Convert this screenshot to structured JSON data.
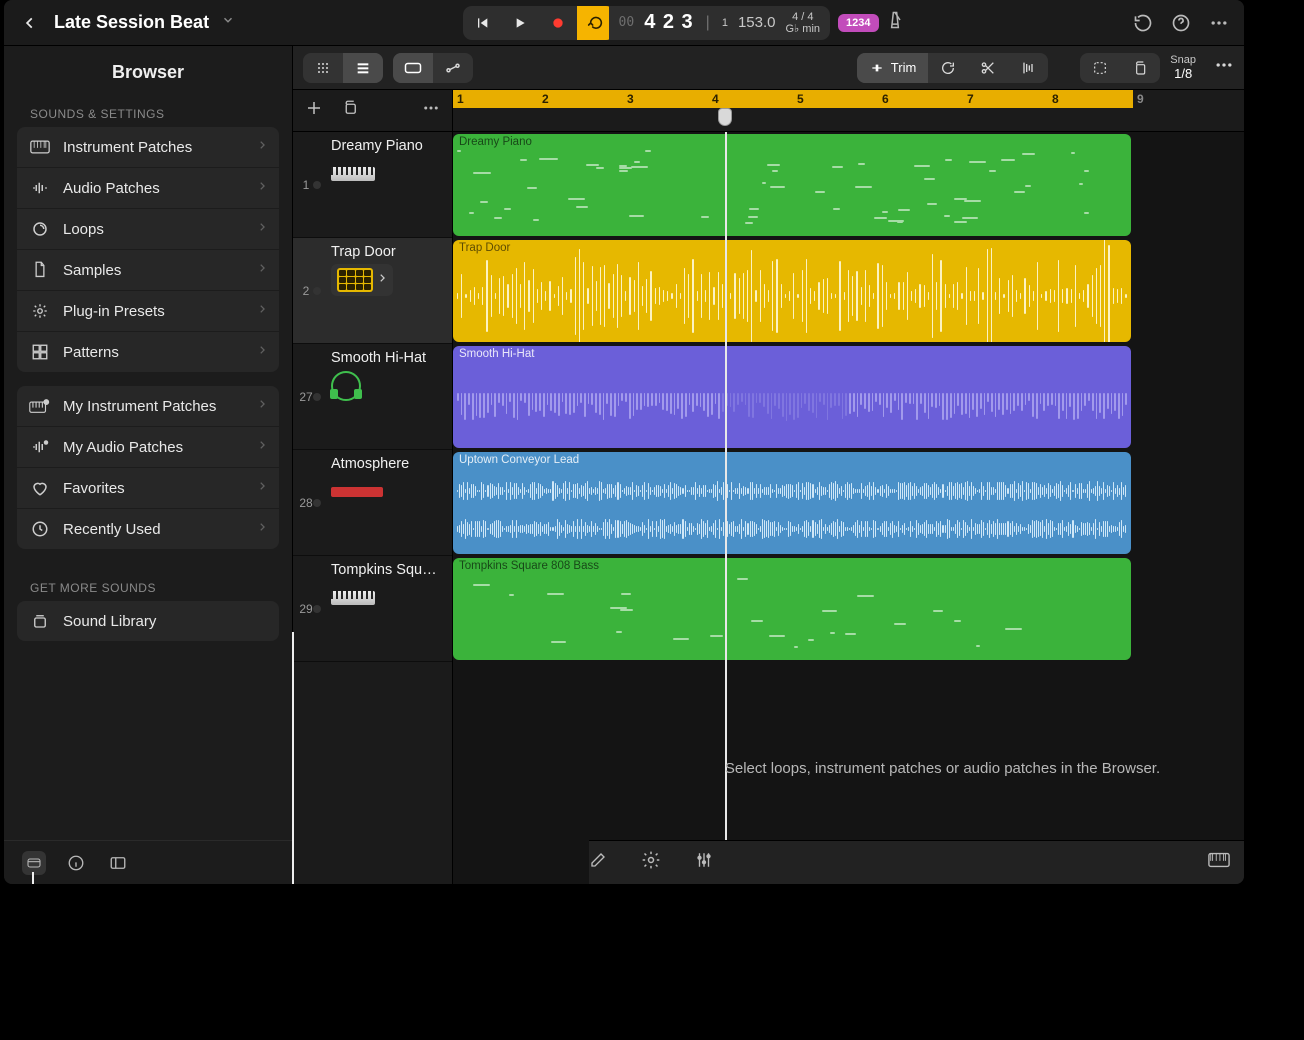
{
  "project": {
    "title": "Late Session Beat"
  },
  "transport": {
    "position": "4 2 3",
    "bar": "1",
    "tempo": "153.0",
    "sig": "4 / 4",
    "key": "G♭ min",
    "countin_badge": "1234"
  },
  "toolbar": {
    "snap_label": "Snap",
    "snap_value": "1/8",
    "trim_label": "Trim"
  },
  "browser": {
    "title": "Browser",
    "s1": "SOUNDS & SETTINGS",
    "soundSettings": [
      "Instrument Patches",
      "Audio Patches",
      "Loops",
      "Samples",
      "Plug-in Presets",
      "Patterns"
    ],
    "myStuff": [
      "My Instrument Patches",
      "My Audio Patches",
      "Favorites",
      "Recently Used"
    ],
    "s3": "GET MORE SOUNDS",
    "library": "Sound Library"
  },
  "tracks": [
    {
      "num": "1",
      "name": "Dreamy Piano",
      "region": "Dreamy Piano",
      "icon": "keyboard",
      "type": "midi",
      "color": "green"
    },
    {
      "num": "2",
      "name": "Trap Door",
      "region": "Trap Door",
      "icon": "drum",
      "type": "audio",
      "color": "yellow",
      "selected": true
    },
    {
      "num": "27",
      "name": "Smooth Hi-Hat",
      "region": "Smooth Hi-Hat",
      "icon": "headphone",
      "type": "pattern",
      "color": "purple"
    },
    {
      "num": "28",
      "name": "Atmosphere",
      "region": "Uptown Conveyor Lead",
      "icon": "nord",
      "type": "audio2",
      "color": "blue"
    },
    {
      "num": "29",
      "name": "Tompkins Squ…",
      "region": "Tompkins Square 808 Bass",
      "icon": "keyboard",
      "type": "midi2",
      "color": "green2"
    }
  ],
  "ruler": {
    "bars": [
      "1",
      "2",
      "3",
      "4",
      "5",
      "6",
      "7",
      "8",
      "9"
    ],
    "cycle_bars": 8,
    "playhead_bar": 4.2
  },
  "hint": "Select loops, instrument patches or audio patches in the Browser."
}
